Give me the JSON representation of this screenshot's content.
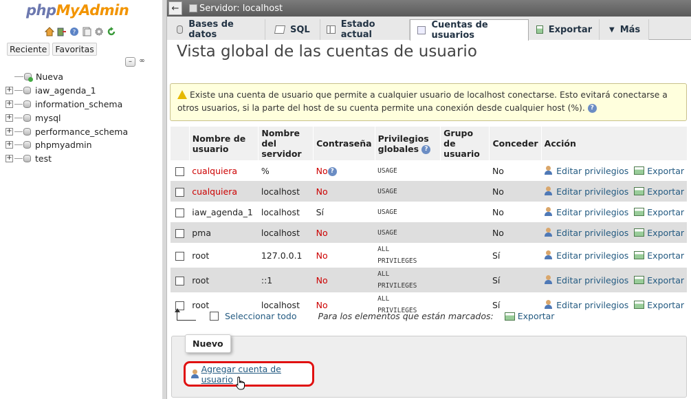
{
  "nav": {
    "logo_php": "php",
    "logo_admin": "MyAdmin",
    "icons": [
      "home-icon",
      "logout-icon",
      "help-icon",
      "docs-icon",
      "settings-icon",
      "reload-icon"
    ],
    "tab_recent": "Reciente",
    "tab_favorites": "Favoritas",
    "tree": [
      {
        "label": "Nueva",
        "type": "new"
      },
      {
        "label": "iaw_agenda_1",
        "type": "db"
      },
      {
        "label": "information_schema",
        "type": "db"
      },
      {
        "label": "mysql",
        "type": "db"
      },
      {
        "label": "performance_schema",
        "type": "db"
      },
      {
        "label": "phpmyadmin",
        "type": "db"
      },
      {
        "label": "test",
        "type": "db"
      }
    ]
  },
  "topbar": {
    "server": "Servidor: localhost"
  },
  "menu": {
    "tabs": [
      {
        "label": "Bases de datos",
        "icon": "database-icon"
      },
      {
        "label": "SQL",
        "icon": "sql-icon"
      },
      {
        "label": "Estado actual",
        "icon": "status-icon"
      },
      {
        "label": "Cuentas de usuarios",
        "icon": "users-icon",
        "active": true
      },
      {
        "label": "Exportar",
        "icon": "export-icon"
      },
      {
        "label": "Más",
        "icon": "caret-down-icon"
      }
    ]
  },
  "page_title": "Vista global de las cuentas de usuario",
  "notice": "Existe una cuenta de usuario que permite a cualquier usuario de localhost conectarse. Esto evitará conectarse a otros usuarios, si la parte del host de su cuenta permite una conexión desde cualquier host (%).",
  "table": {
    "headers": {
      "user": "Nombre de usuario",
      "host": "Nombre del servidor",
      "password": "Contraseña",
      "privileges": "Privilegios globales",
      "group": "Grupo de usuario",
      "grant": "Conceder",
      "action": "Acción"
    },
    "rows": [
      {
        "user": "cualquiera",
        "user_red": true,
        "host": "%",
        "password": "No",
        "password_help": true,
        "priv1": "USAGE",
        "priv2": "",
        "group": "",
        "grant": "No"
      },
      {
        "user": "cualquiera",
        "user_red": true,
        "host": "localhost",
        "password": "No",
        "password_help": false,
        "priv1": "USAGE",
        "priv2": "",
        "group": "",
        "grant": "No"
      },
      {
        "user": "iaw_agenda_1",
        "user_red": false,
        "host": "localhost",
        "password": "Sí",
        "password_help": false,
        "priv1": "USAGE",
        "priv2": "",
        "group": "",
        "grant": "No"
      },
      {
        "user": "pma",
        "user_red": false,
        "host": "localhost",
        "password": "No",
        "password_help": false,
        "priv1": "USAGE",
        "priv2": "",
        "group": "",
        "grant": "No"
      },
      {
        "user": "root",
        "user_red": false,
        "host": "127.0.0.1",
        "password": "No",
        "password_help": false,
        "priv1": "ALL",
        "priv2": "PRIVILEGES",
        "group": "",
        "grant": "Sí"
      },
      {
        "user": "root",
        "user_red": false,
        "host": "::1",
        "password": "No",
        "password_help": false,
        "priv1": "ALL",
        "priv2": "PRIVILEGES",
        "group": "",
        "grant": "Sí"
      },
      {
        "user": "root",
        "user_red": false,
        "host": "localhost",
        "password": "No",
        "password_help": false,
        "priv1": "ALL",
        "priv2": "PRIVILEGES",
        "group": "",
        "grant": "Sí"
      }
    ],
    "edit_label": "Editar privilegios",
    "export_label": "Exportar"
  },
  "footer": {
    "select_all": "Seleccionar todo",
    "marked": "Para los elementos que están marcados:",
    "export": "Exportar"
  },
  "new_section": {
    "legend": "Nuevo",
    "add_user": "Agregar cuenta de usuario"
  },
  "colors": {
    "highlight": "#e01010",
    "link": "#235a81",
    "red_text": "#cc0000"
  }
}
